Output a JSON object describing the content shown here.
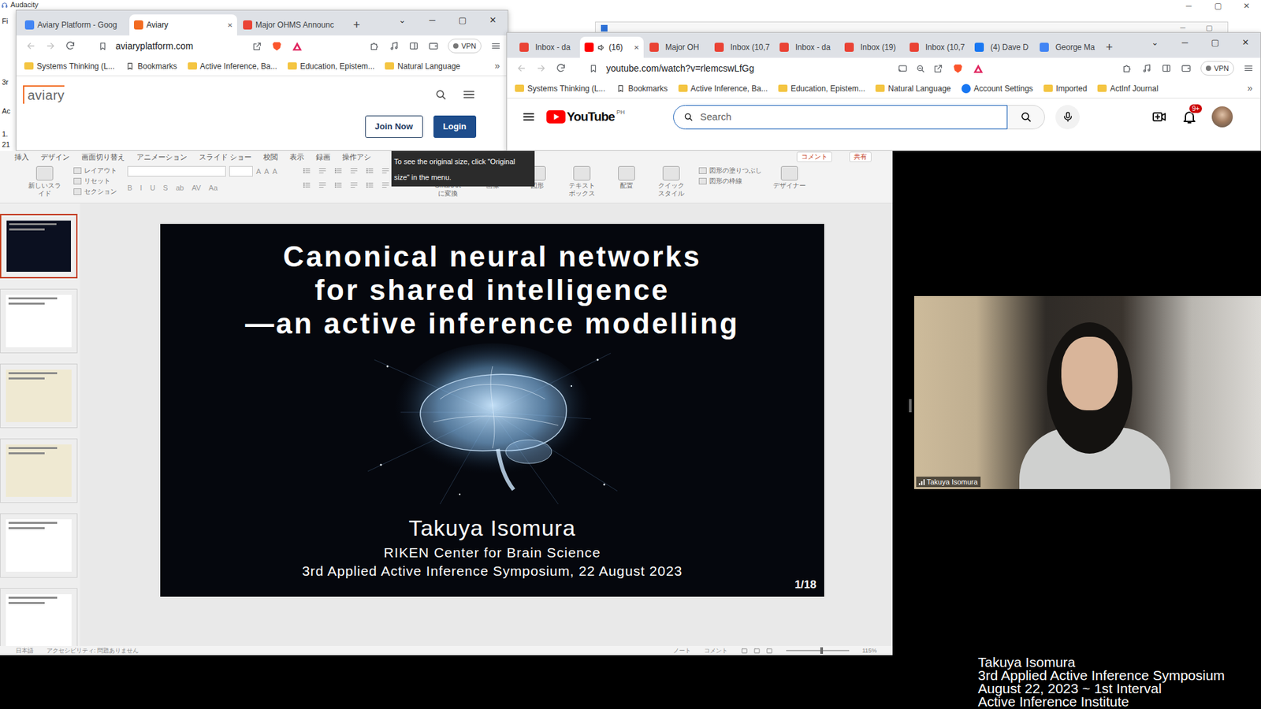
{
  "audacity": {
    "title": "Audacity",
    "fragments": [
      "Fi",
      "3r",
      "Ac",
      "1.",
      "21"
    ],
    "controls": [
      "─",
      "▢",
      "✕"
    ]
  },
  "background_window": {
    "controls": [
      "─",
      "▢"
    ]
  },
  "left_browser": {
    "tabs": [
      {
        "label": "Aviary Platform - Goog",
        "selected": false,
        "color": "#4285f4"
      },
      {
        "label": "Aviary",
        "selected": true,
        "color": "#f26b21"
      },
      {
        "label": "Major OHMS Announc",
        "selected": false,
        "color": "#ea4335"
      }
    ],
    "close_tab": "✕",
    "new_tab": "+",
    "controls": [
      "⌄",
      "─",
      "▢",
      "✕"
    ],
    "url": "aviaryplatform.com",
    "vpn": "VPN",
    "bookmarks": [
      {
        "label": "Systems Thinking (L...",
        "kind": "folder"
      },
      {
        "label": "Bookmarks",
        "kind": "manager"
      },
      {
        "label": "Active Inference, Ba...",
        "kind": "folder"
      },
      {
        "label": "Education, Epistem...",
        "kind": "folder"
      },
      {
        "label": "Natural Language",
        "kind": "folder"
      }
    ],
    "more": "»",
    "page": {
      "logo": "aviary",
      "buttons": [
        {
          "label": "Join Now",
          "kind": "outline"
        },
        {
          "label": "Login",
          "kind": "filled"
        }
      ]
    }
  },
  "right_browser": {
    "tabs": [
      {
        "label": "Inbox - da",
        "selected": false,
        "audio": false,
        "color": "#ea4335"
      },
      {
        "label": "(16)",
        "selected": true,
        "audio": true,
        "color": "#ff0000"
      },
      {
        "label": "Major OH",
        "selected": false,
        "audio": false,
        "color": "#ea4335"
      },
      {
        "label": "Inbox (10,7",
        "selected": false,
        "audio": false,
        "color": "#ea4335"
      },
      {
        "label": "Inbox - da",
        "selected": false,
        "audio": false,
        "color": "#ea4335"
      },
      {
        "label": "Inbox (19)",
        "selected": false,
        "audio": false,
        "color": "#ea4335"
      },
      {
        "label": "Inbox (10,7",
        "selected": false,
        "audio": false,
        "color": "#ea4335"
      },
      {
        "label": "(4) Dave D",
        "selected": false,
        "audio": false,
        "color": "#1877f2"
      },
      {
        "label": "George Ma",
        "selected": false,
        "audio": false,
        "color": "#4285f4"
      }
    ],
    "close_tab": "✕",
    "new_tab": "+",
    "controls": [
      "⌄",
      "─",
      "▢",
      "✕"
    ],
    "url": "youtube.com/watch?v=rlemcswLfGg",
    "vpn": "VPN",
    "bookmarks": [
      {
        "label": "Systems Thinking (L...",
        "kind": "folder"
      },
      {
        "label": "Bookmarks",
        "kind": "manager"
      },
      {
        "label": "Active Inference, Ba...",
        "kind": "folder"
      },
      {
        "label": "Education, Epistem...",
        "kind": "folder"
      },
      {
        "label": "Natural Language",
        "kind": "folder"
      },
      {
        "label": "Account Settings",
        "kind": "site"
      },
      {
        "label": "Imported",
        "kind": "folder"
      },
      {
        "label": "ActInf Journal",
        "kind": "folder"
      }
    ],
    "more": "»",
    "youtube": {
      "logo": "YouTube",
      "region": "PH",
      "search_placeholder": "Search",
      "notifications": "9+"
    }
  },
  "presentation": {
    "ribbon_tabs": [
      "挿入",
      "デザイン",
      "画面切り替え",
      "アニメーション",
      "スライド ショー",
      "校閲",
      "表示",
      "録画",
      "操作アシ"
    ],
    "comment_button": "コメント",
    "share_button": "共有",
    "tooltip": "To see the original size, click \"Original size\" in the menu.",
    "new_slide": "新しいスライド",
    "slide_commands": [
      "レイアウト",
      "リセット",
      "セクション"
    ],
    "font_glyphs": [
      "A",
      "A",
      "A"
    ],
    "format_glyphs": [
      "B",
      "I",
      "U",
      "S",
      "ab",
      "AV",
      "Aa"
    ],
    "insert_commands": [
      "SmartArt に変換",
      "画像",
      "図形",
      "テキスト ボックス",
      "配置",
      "クイック スタイル"
    ],
    "shape_commands": [
      "図形の塗りつぶし",
      "図形の枠線"
    ],
    "designer": "デザイナー",
    "thumbnails": [
      {
        "selected": true,
        "color": "#0b1020"
      },
      {
        "selected": false,
        "color": "#ffffff"
      },
      {
        "selected": false,
        "color": "#efe9d2"
      },
      {
        "selected": false,
        "color": "#efe9d2"
      },
      {
        "selected": false,
        "color": "#ffffff"
      },
      {
        "selected": false,
        "color": "#ffffff"
      }
    ],
    "slide": {
      "title_lines": [
        "Canonical neural networks",
        "for shared intelligence",
        "—an active inference modelling"
      ],
      "author": "Takuya Isomura",
      "affiliation": "RIKEN Center for Brain Science",
      "event": "3rd Applied Active Inference Symposium, 22 August 2023",
      "page": "1/18"
    },
    "status": {
      "language": "日本語",
      "accessibility": "アクセシビリティ: 問題ありません",
      "notes": "ノート",
      "comments": "コメント",
      "zoom": "115%",
      "zoom_level": 0.55
    }
  },
  "video": {
    "name": "Takuya Isomura"
  },
  "caption": [
    "Takuya Isomura",
    "3rd Applied Active Inference Symposium",
    "August 22, 2023 ~ 1st Interval",
    "Active Inference Institute"
  ]
}
